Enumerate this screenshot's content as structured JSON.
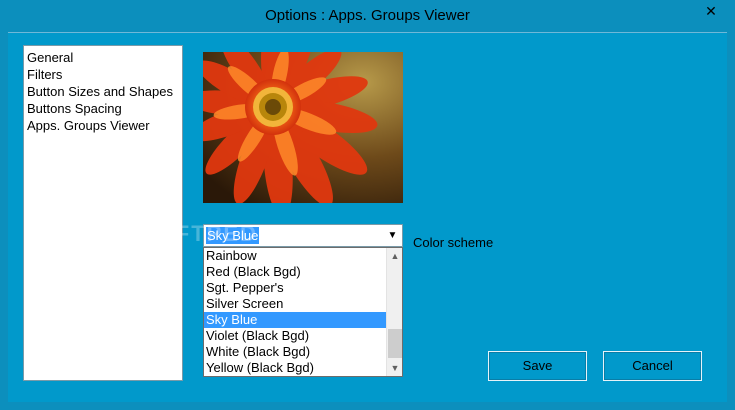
{
  "window": {
    "title": "Options : Apps. Groups Viewer",
    "close_glyph": "✕"
  },
  "nav": {
    "items": [
      {
        "label": "General"
      },
      {
        "label": "Filters"
      },
      {
        "label": "Button Sizes and Shapes"
      },
      {
        "label": "Buttons Spacing"
      },
      {
        "label": "Apps. Groups Viewer"
      }
    ],
    "selected": "Apps. Groups Viewer"
  },
  "color_scheme": {
    "label": "Color scheme",
    "selected": "Sky Blue",
    "options": [
      {
        "label": "Rainbow"
      },
      {
        "label": "Red (Black Bgd)"
      },
      {
        "label": "Sgt. Pepper's"
      },
      {
        "label": "Silver Screen"
      },
      {
        "label": "Sky Blue"
      },
      {
        "label": "Violet (Black Bgd)"
      },
      {
        "label": "White (Black Bgd)"
      },
      {
        "label": "Yellow (Black Bgd)"
      }
    ],
    "highlighted_index": 4
  },
  "buttons": {
    "save": "Save",
    "cancel": "Cancel"
  },
  "watermark": "SOFTPEDIA",
  "colors": {
    "background": "#0199cb",
    "selection": "#3399ff"
  },
  "icons": {
    "close": "close-icon",
    "dropdown": "chevron-down-icon",
    "scroll_up": "triangle-up-icon",
    "scroll_down": "triangle-down-icon"
  }
}
